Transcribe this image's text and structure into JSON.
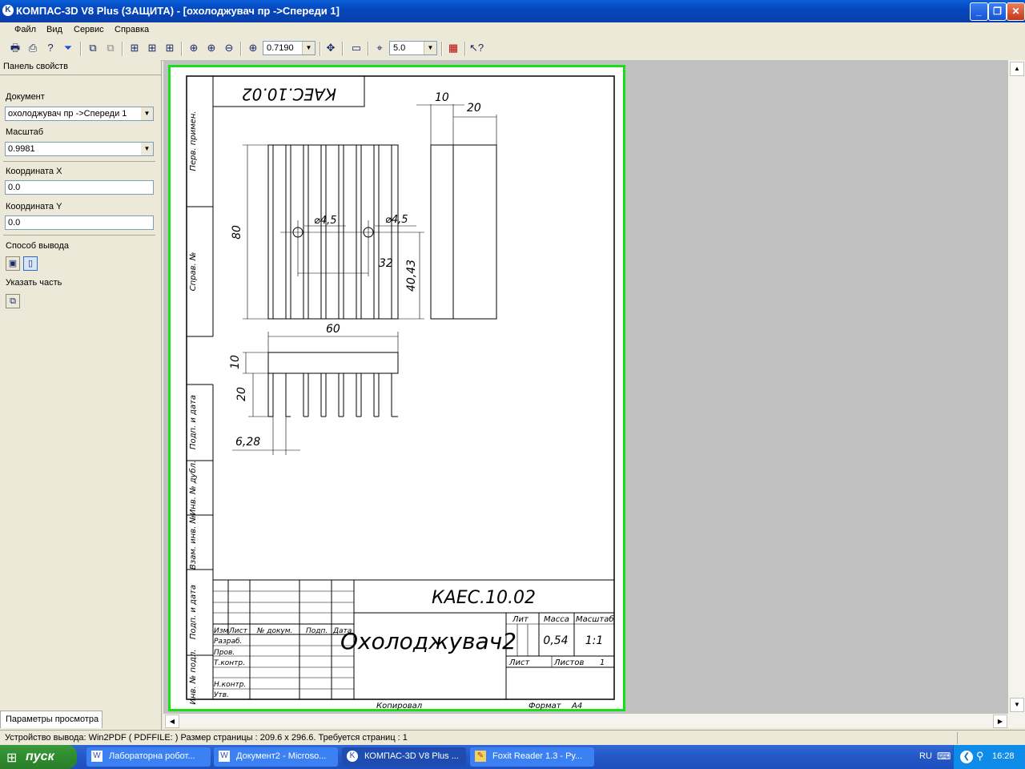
{
  "window": {
    "title": "КОМПАС-3D V8 Plus (ЗАЩИТА) - [охолоджувач пр ->Спереди 1]"
  },
  "menu": [
    "Файл",
    "Вид",
    "Сервис",
    "Справка"
  ],
  "toolbar": {
    "zoom_value": "0.7190",
    "step_value": "5.0"
  },
  "panel": {
    "tab_title": "Панель свойств",
    "document_label": "Документ",
    "document_value": "охолоджувач пр ->Спереди 1",
    "scale_label": "Масштаб",
    "scale_value": "0.9981",
    "coord_x_label": "Координата X",
    "coord_x_value": "0.0",
    "coord_y_label": "Координата Y",
    "coord_y_value": "0.0",
    "output_label": "Способ вывода",
    "part_label": "Указать часть",
    "bottom_tab": "Параметры просмотра"
  },
  "drawing": {
    "code_top": "КАЕС.10.02",
    "code_stamp": "КАЕС.10.02",
    "name": "Охолоджувач2",
    "mass": "0,54",
    "scale": "1:1",
    "sheets": "1",
    "col_lit": "Лит",
    "col_mass": "Масса",
    "col_scale": "Масштаб",
    "col_sheet": "Лист",
    "col_sheets": "Листов",
    "row_labels": [
      "Изм",
      "Лист",
      "№ докум.",
      "Подп.",
      "Дата"
    ],
    "roles": [
      "Разраб.",
      "Пров.",
      "Т.контр.",
      "Н.контр.",
      "Утв."
    ],
    "side_labels": [
      "Перв. примен.",
      "Справ. №",
      "Подп. и дата",
      "Инв. № дубл.",
      "Взам. инв. №",
      "Подп. и дата",
      "Инв. № подл."
    ],
    "copied": "Копировал",
    "format": "Формат",
    "format_value": "А4",
    "dims": {
      "d10_top": "10",
      "d20_top": "20",
      "h80": "80",
      "dia1": "⌀4,5",
      "dia2": "⌀4,5",
      "d32": "32",
      "d40_43": "40,43",
      "w60": "60",
      "d10_side": "10",
      "d20_side": "20",
      "d6_28": "6,28"
    }
  },
  "status": {
    "text": "Устройство вывода: Win2PDF ( PDFFILE: )  Размер страницы : 209.6 x 296.6.  Требуется страниц : 1"
  },
  "taskbar": {
    "start": "пуск",
    "tasks": [
      "Лабораторна  робот...",
      "Документ2 - Microso...",
      "КОМПАС-3D V8 Plus ...",
      "Foxit Reader 1.3 - Ру..."
    ],
    "lang": "RU",
    "time": "16:28"
  }
}
